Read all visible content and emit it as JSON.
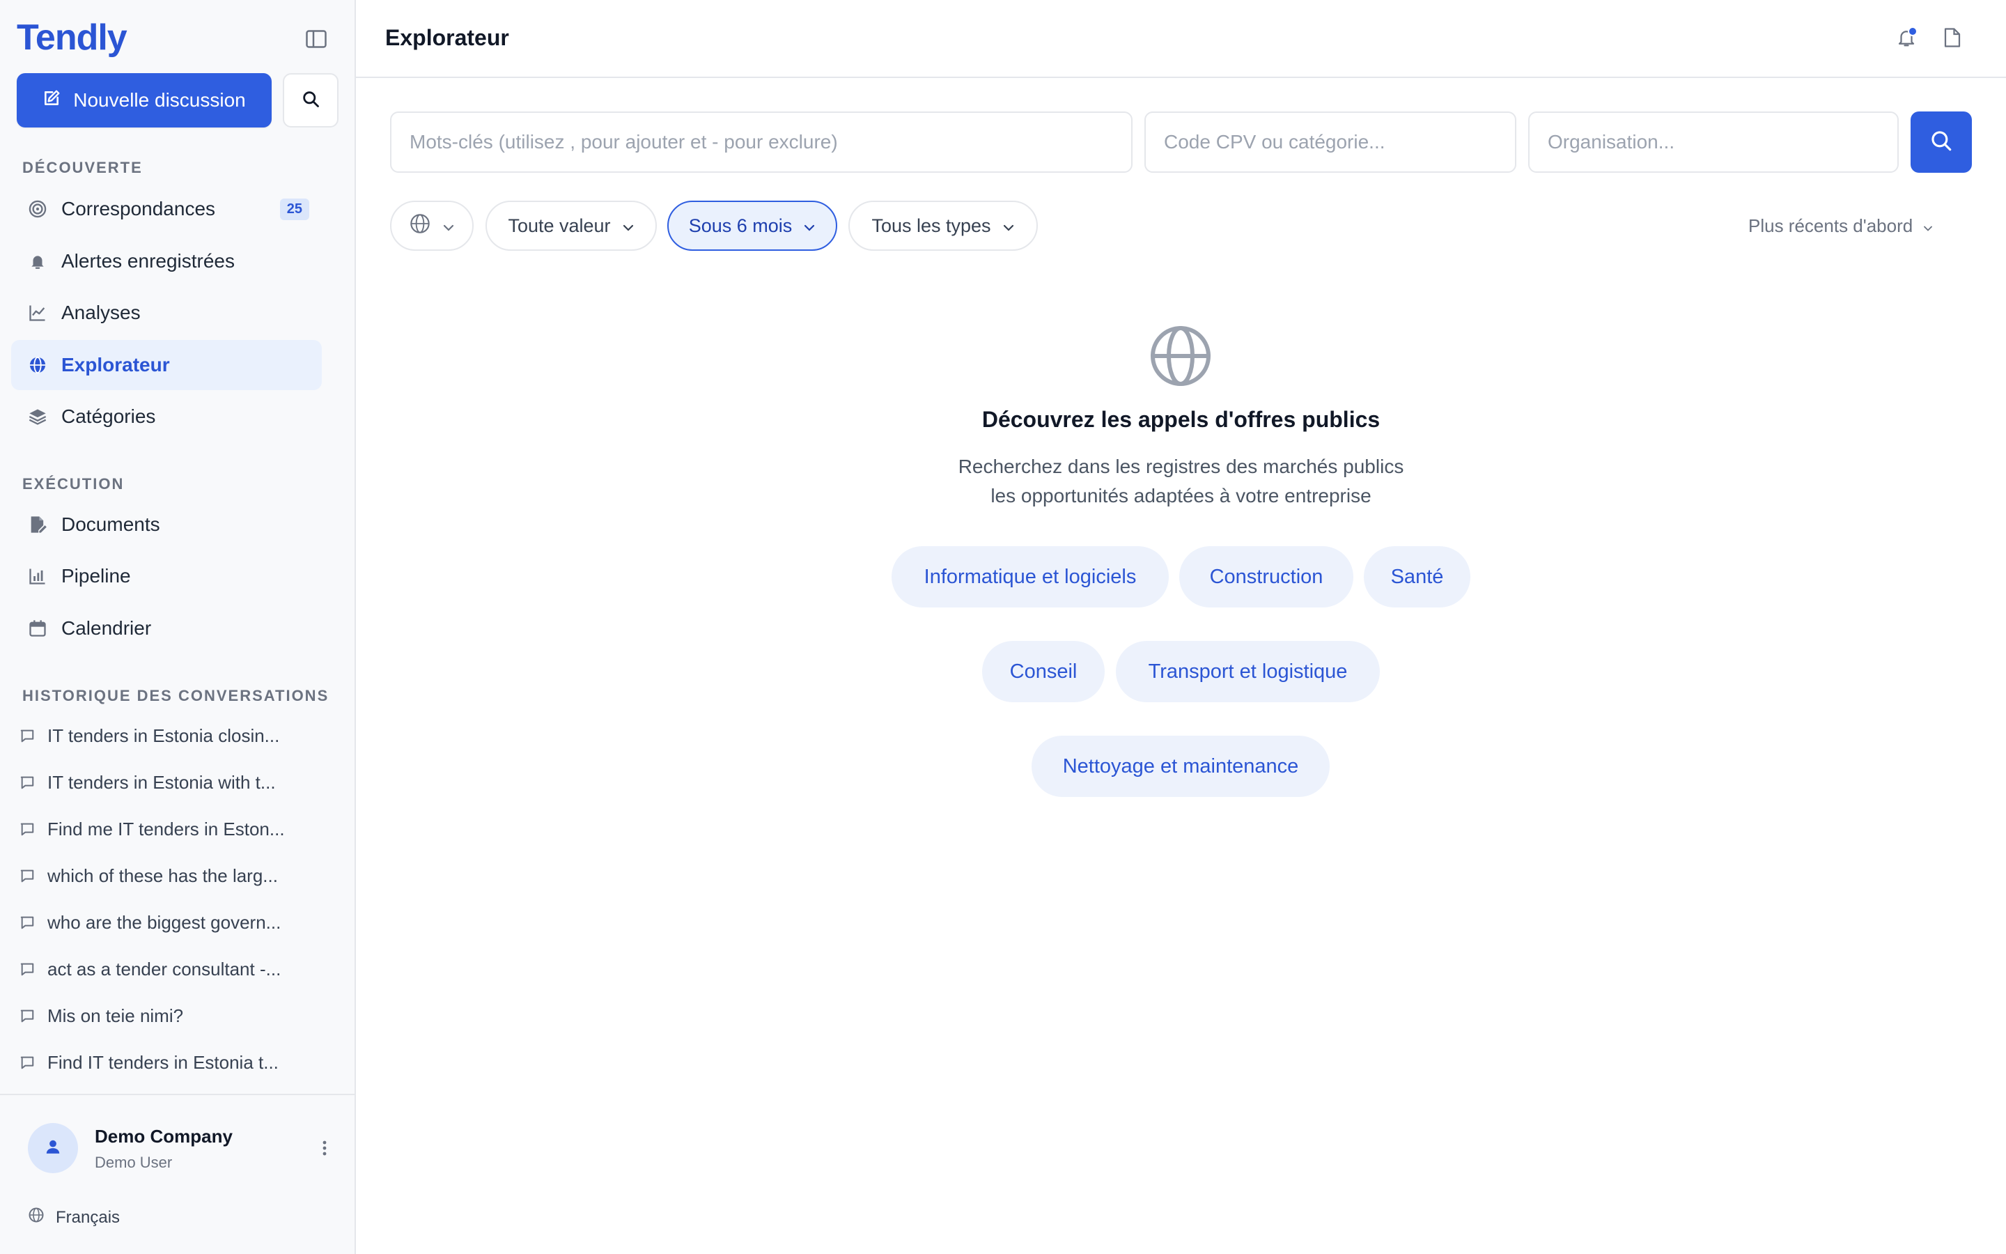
{
  "app": {
    "name": "Tendly"
  },
  "sidebar": {
    "new_chat_label": "Nouvelle discussion",
    "sections": {
      "discovery": "DÉCOUVERTE",
      "execution": "EXÉCUTION",
      "history": "HISTORIQUE DES CONVERSATIONS"
    },
    "discovery_items": [
      {
        "label": "Correspondances",
        "icon": "target-icon",
        "badge": "25"
      },
      {
        "label": "Alertes enregistrées",
        "icon": "bell-icon"
      },
      {
        "label": "Analyses",
        "icon": "line-chart-icon"
      },
      {
        "label": "Explorateur",
        "icon": "globe-icon",
        "active": true
      },
      {
        "label": "Catégories",
        "icon": "layers-icon"
      }
    ],
    "execution_items": [
      {
        "label": "Documents",
        "icon": "file-edit-icon"
      },
      {
        "label": "Pipeline",
        "icon": "bar-chart-icon"
      },
      {
        "label": "Calendrier",
        "icon": "calendar-icon"
      }
    ],
    "history_items": [
      "IT tenders in Estonia closin...",
      "IT tenders in Estonia with t...",
      "Find me IT tenders in Eston...",
      "which of these has the larg...",
      "who are the biggest govern...",
      "act as a tender consultant -...",
      "Mis on teie nimi?",
      "Find IT tenders in Estonia t..."
    ],
    "user": {
      "company": "Demo Company",
      "name": "Demo User"
    },
    "language": "Français"
  },
  "header": {
    "title": "Explorateur"
  },
  "search": {
    "keywords_placeholder": "Mots-clés (utilisez , pour ajouter et - pour exclure)",
    "cpv_placeholder": "Code CPV ou catégorie...",
    "org_placeholder": "Organisation..."
  },
  "filters": {
    "value": "Toute valeur",
    "period": "Sous 6 mois",
    "types": "Tous les types",
    "sort": "Plus récents d'abord"
  },
  "empty_state": {
    "title": "Découvrez les appels d'offres publics",
    "subtitle_line1": "Recherchez dans les registres des marchés publics",
    "subtitle_line2": "les opportunités adaptées à votre entreprise",
    "chips": [
      "Informatique et logiciels",
      "Construction",
      "Santé",
      "Conseil",
      "Transport et logistique",
      "Nettoyage et maintenance"
    ]
  },
  "colors": {
    "brand": "#2b55d4",
    "primary_button": "#2f5ee0",
    "active_bg": "#eaf1fd",
    "chip_bg": "#edf2fc"
  }
}
